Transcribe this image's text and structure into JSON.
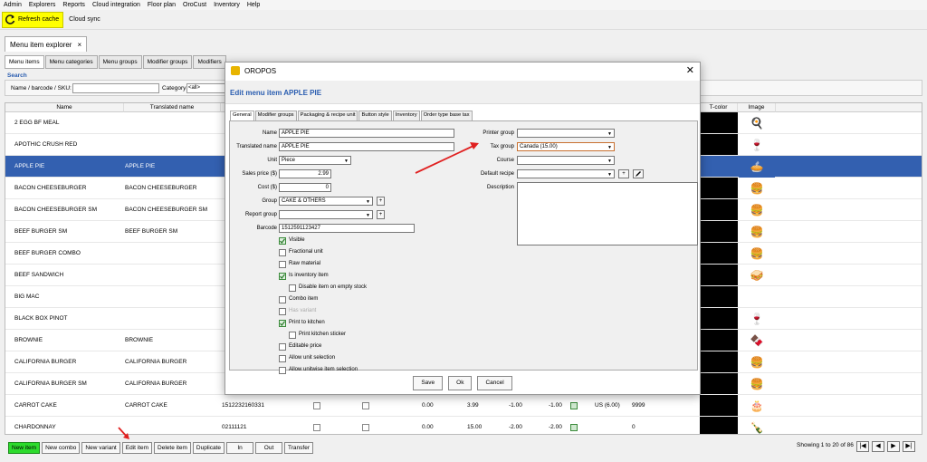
{
  "menubar": [
    "Admin",
    "Explorers",
    "Reports",
    "Cloud integration",
    "Floor plan",
    "OroCust",
    "Inventory",
    "Help"
  ],
  "toolbar": {
    "refresh_label": "Refresh cache",
    "cloud_label": "Cloud sync"
  },
  "doc_tab": {
    "label": "Menu item explorer",
    "close": "×"
  },
  "subtabs": [
    "Menu items",
    "Menu categories",
    "Menu groups",
    "Modifier groups",
    "Modifiers"
  ],
  "search": {
    "heading": "Search",
    "name_label": "Name / barcode / SKU:",
    "category_label": "Category",
    "category_value": "<all>"
  },
  "grid": {
    "headers": {
      "name": "Name",
      "translated": "Translated name",
      "tcolor": "T-color",
      "image": "Image"
    },
    "rows": [
      {
        "name": "2 EGG BF MEAL",
        "translated": "",
        "code": "",
        "img": "food"
      },
      {
        "name": "APOTHIC CRUSH RED",
        "translated": "",
        "code": "",
        "img": "wine"
      },
      {
        "name": "APPLE PIE",
        "translated": "APPLE PIE",
        "code": "",
        "img": "pie",
        "selected": true
      },
      {
        "name": "BACON CHEESEBURGER",
        "translated": "BACON CHEESEBURGER",
        "code": "",
        "img": "burger"
      },
      {
        "name": "BACON CHEESEBURGER SM",
        "translated": "BACON CHEESEBURGER SM",
        "code": "",
        "img": "burger"
      },
      {
        "name": "BEEF BURGER  SM",
        "translated": "BEEF BURGER  SM",
        "code": "",
        "img": "burger"
      },
      {
        "name": "BEEF BURGER COMBO",
        "translated": "",
        "code": "",
        "img": "burger"
      },
      {
        "name": "BEEF SANDWICH",
        "translated": "",
        "code": "",
        "img": "sandwich"
      },
      {
        "name": "BIG MAC",
        "translated": "",
        "code": "",
        "img": ""
      },
      {
        "name": "BLACK BOX PINOT",
        "translated": "",
        "code": "",
        "img": "wine"
      },
      {
        "name": "BROWNIE",
        "translated": "BROWNIE",
        "code": "",
        "img": "brownie"
      },
      {
        "name": "CALIFORNIA BURGER",
        "translated": "CALIFORNIA BURGER",
        "code": "",
        "img": "burger"
      },
      {
        "name": "CALIFORNIA BURGER SM",
        "translated": "CALIFORNIA BURGER",
        "code": "",
        "img": "burger"
      },
      {
        "name": "CARROT CAKE",
        "translated": "CARROT CAKE",
        "code": "1512232160331",
        "img": "cake",
        "p1": "0.00",
        "p2": "3.99",
        "p3": "-1.00",
        "p4": "-1.00",
        "tax": "US (6.00)",
        "q": "9999"
      },
      {
        "name": "CHARDONNAY",
        "translated": "",
        "code": "02111121",
        "img": "wine2",
        "p1": "0.00",
        "p2": "15.00",
        "p3": "-2.00",
        "p4": "-2.00",
        "tax": "",
        "q": "0"
      }
    ]
  },
  "bottom": {
    "buttons": [
      "New item",
      "New combo",
      "New variant",
      "Edit item",
      "Delete item",
      "Duplicate",
      "In",
      "Out",
      "Transfer"
    ],
    "showing": "Showing 1 to 20 of 86",
    "pager": [
      "|◀",
      "◀",
      "▶",
      "▶|"
    ]
  },
  "dialog": {
    "title": "OROPOS",
    "heading": "Edit menu item APPLE PIE",
    "tabs": [
      "General",
      "Modifier groups",
      "Packaging & recipe unit",
      "Button style",
      "Inventory",
      "Order type base tax"
    ],
    "fields": {
      "name_label": "Name",
      "name": "APPLE PIE",
      "tname_label": "Translated name",
      "tname": "APPLE PIE",
      "unit_label": "Unit",
      "unit": "Piece",
      "sales_label": "Sales price ($)",
      "sales": "2.99",
      "cost_label": "Cost ($)",
      "cost": "0",
      "group_label": "Group",
      "group": "CAKE & OTHERS",
      "report_label": "Report group",
      "report": "",
      "barcode_label": "Barcode",
      "barcode": "1512591123427",
      "printer_label": "Printer group",
      "printer": "",
      "tax_label": "Tax group",
      "tax": "Canada (15.00)",
      "course_label": "Course",
      "course": "",
      "recipe_label": "Default recipe",
      "recipe": "",
      "desc_label": "Description"
    },
    "checks": [
      {
        "label": "Visible",
        "on": true,
        "indent": 0
      },
      {
        "label": "Fractional unit",
        "on": false,
        "indent": 0
      },
      {
        "label": "Raw material",
        "on": false,
        "indent": 0
      },
      {
        "label": "Is inventory item",
        "on": true,
        "indent": 0
      },
      {
        "label": "Disable item on empty stock",
        "on": false,
        "indent": 1
      },
      {
        "label": "Combo item",
        "on": false,
        "indent": 0
      },
      {
        "label": "Has variant",
        "on": false,
        "indent": 0,
        "disabled": true
      },
      {
        "label": "Print to kitchen",
        "on": true,
        "indent": 0
      },
      {
        "label": "Print kitchen sticker",
        "on": false,
        "indent": 1
      },
      {
        "label": "Editable price",
        "on": false,
        "indent": 0
      },
      {
        "label": "Allow unit selection",
        "on": false,
        "indent": 0
      },
      {
        "label": "Allow unitwise item selection",
        "on": false,
        "indent": 0
      }
    ],
    "buttons": {
      "save": "Save",
      "ok": "Ok",
      "cancel": "Cancel"
    }
  },
  "colors": {
    "selected_row": "#3360b0",
    "accent_text": "#2a5db0",
    "refresh_bg": "#ffff00",
    "new_item_bg": "#2ddb2d",
    "arrow": "#e02020"
  }
}
